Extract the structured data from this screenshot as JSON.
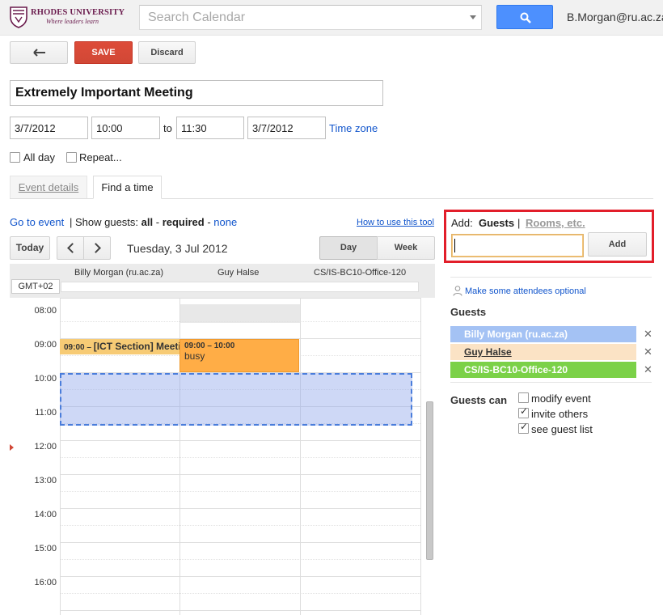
{
  "header": {
    "logo_name": "RHODES UNIVERSITY",
    "logo_tagline": "Where leaders learn",
    "search_placeholder": "Search Calendar",
    "account": "B.Morgan@ru.ac.za"
  },
  "toolbar": {
    "save_label": "SAVE",
    "discard_label": "Discard"
  },
  "event": {
    "title": "Extremely Important Meeting",
    "start_date": "3/7/2012",
    "start_time": "10:00",
    "to_label": "to",
    "end_time": "11:30",
    "end_date": "3/7/2012",
    "timezone_link": "Time zone",
    "all_day_label": "All day",
    "repeat_label": "Repeat..."
  },
  "tabs": {
    "event_details": "Event details",
    "find_a_time": "Find a time"
  },
  "find_time": {
    "go_to_event": "Go to event",
    "show_guests_prefix": " | Show guests: ",
    "all": "all",
    "sep": " - ",
    "required": "required",
    "sep2": " - ",
    "none": "none",
    "how_to_link": "How to use this tool",
    "today": "Today",
    "date": "Tuesday, 3 Jul 2012",
    "day": "Day",
    "week": "Week",
    "timezone": "GMT+02",
    "columns": [
      "Billy Morgan (ru.ac.za)",
      "Guy Halse",
      "CS/IS-BC10-Office-120"
    ],
    "hours": [
      "08:00",
      "09:00",
      "10:00",
      "11:00",
      "12:00",
      "13:00",
      "14:00",
      "15:00",
      "16:00"
    ],
    "events": [
      {
        "time": "09:00 – ",
        "title": "[ICT Section] Meeti"
      },
      {
        "time": "09:00 – 10:00",
        "title": "busy"
      }
    ]
  },
  "add_panel": {
    "add_label": "Add:",
    "guests_tab": "Guests",
    "pipe": "|",
    "rooms_tab": "Rooms, etc.",
    "add_button": "Add"
  },
  "guests": {
    "optional_link": "Make some attendees optional",
    "heading": "Guests",
    "list": [
      "Billy Morgan (ru.ac.za)",
      "Guy Halse",
      "CS/IS-BC10-Office-120"
    ],
    "remove_glyph": "✕",
    "can_heading": "Guests can",
    "permissions": [
      {
        "label": "modify event",
        "checked": false
      },
      {
        "label": "invite others",
        "checked": true
      },
      {
        "label": "see guest list",
        "checked": true
      }
    ]
  },
  "colors": {
    "save": "#d14836",
    "search": "#4d90fe",
    "guest_1": "#a4c2f4",
    "guest_2": "#fbe3c5",
    "guest_3": "#7bd148",
    "highlight": "#e21e2a"
  }
}
